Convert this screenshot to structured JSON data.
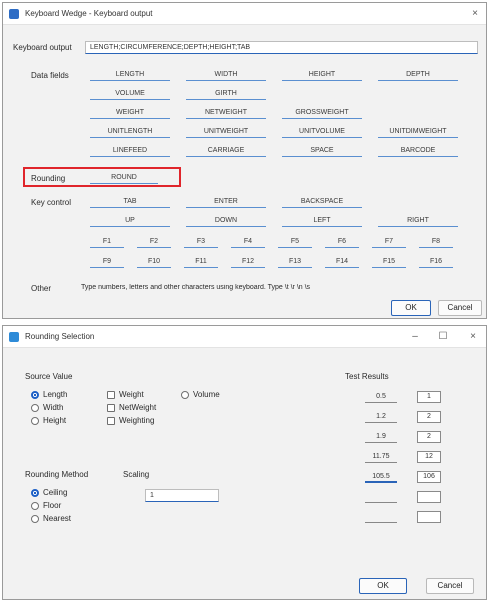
{
  "keyboard_dialog": {
    "title": "Keyboard Wedge - Keyboard output",
    "close_glyph": "×",
    "keyboard_output_label": "Keyboard output",
    "keyboard_output_value": "LENGTH;CIRCUMFERENCE;DEPTH;HEIGHT;TAB",
    "rows": [
      {
        "label": "Data fields",
        "cells": [
          "LENGTH",
          "WIDTH",
          "HEIGHT",
          "DEPTH"
        ]
      },
      {
        "label": "",
        "cells": [
          "VOLUME",
          "GIRTH"
        ]
      },
      {
        "label": "",
        "cells": [
          "WEIGHT",
          "NETWEIGHT",
          "GROSSWEIGHT"
        ]
      },
      {
        "label": "",
        "cells": [
          "UNITLENGTH",
          "UNITWEIGHT",
          "UNITVOLUME",
          "UNITDIMWEIGHT"
        ]
      },
      {
        "label": "",
        "cells": [
          "LINEFEED",
          "CARRIAGE",
          "SPACE",
          "BARCODE"
        ]
      }
    ],
    "rounding_label": "Rounding",
    "rounding_value": "ROUND",
    "key_label": "Key control",
    "key_rows": [
      [
        "TAB",
        "ENTER",
        "BACKSPACE"
      ],
      [
        "UP",
        "DOWN",
        "LEFT",
        "RIGHT"
      ],
      [
        "F1",
        "F2",
        "F3",
        "F4",
        "F5",
        "F6",
        "F7",
        "F8"
      ],
      [
        "F9",
        "F10",
        "F11",
        "F12",
        "F13",
        "F14",
        "F15",
        "F16"
      ]
    ],
    "other_label": "Other",
    "other_text": "Type numbers, letters and other characters using keyboard. Type \\t \\r \\n \\s",
    "ok_label": "OK",
    "cancel_label": "Cancel"
  },
  "rounding_dialog": {
    "title": "Rounding Selection",
    "minimize_glyph": "–",
    "maximize_glyph": "☐",
    "close_glyph": "×",
    "source_value_label": "Source Value",
    "source_options": [
      {
        "type": "radio",
        "label": "Length",
        "selected": true
      },
      {
        "type": "check",
        "label": "Weight",
        "checked": false
      },
      {
        "type": "radio",
        "label": "Volume",
        "selected": false
      },
      {
        "type": "radio",
        "label": "Width",
        "selected": false
      },
      {
        "type": "check",
        "label": "NetWeight",
        "checked": false
      },
      {
        "type": "radio",
        "label": "Height",
        "selected": false
      },
      {
        "type": "check",
        "label": "Weighting",
        "checked": false
      }
    ],
    "rounding_method_label": "Rounding Method",
    "method_options": [
      {
        "label": "Ceiling",
        "selected": true
      },
      {
        "label": "Floor",
        "selected": false
      },
      {
        "label": "Nearest",
        "selected": false
      }
    ],
    "scaling_label": "Scaling",
    "scaling_value": "1",
    "test_results_label": "Test Results",
    "test_inputs": [
      "0.5",
      "1.2",
      "1.9",
      "11.75",
      "105.5",
      "",
      ""
    ],
    "test_outputs": [
      "1",
      "2",
      "2",
      "12",
      "106",
      "",
      ""
    ],
    "ok_label": "OK",
    "cancel_label": "Cancel"
  }
}
